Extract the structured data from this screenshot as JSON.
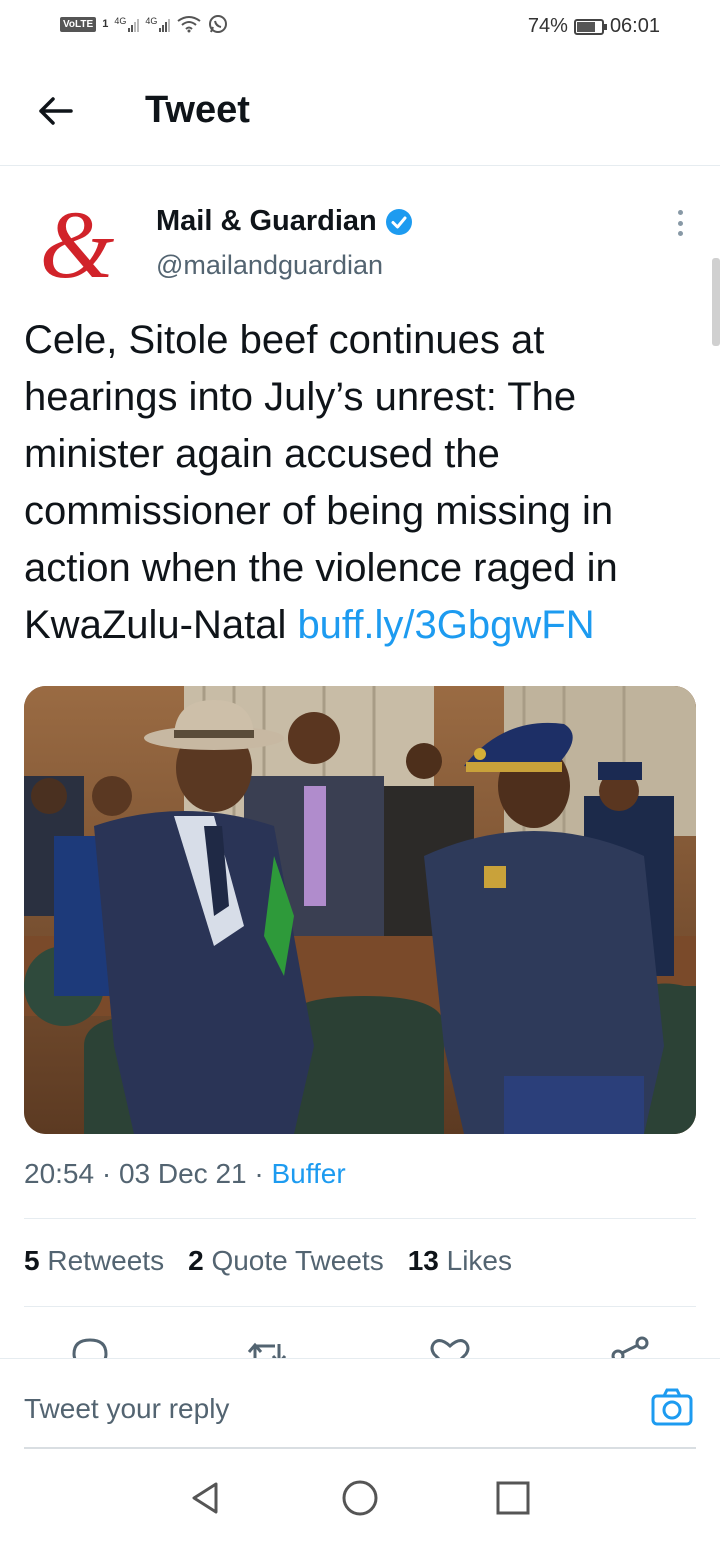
{
  "status_bar": {
    "volte": "VoLTE",
    "sim": "1",
    "net1": "4G",
    "net2": "4G",
    "battery": "74%",
    "battery_level": 0.74,
    "time": "06:01"
  },
  "header": {
    "title": "Tweet",
    "back_icon": "arrow-left-icon"
  },
  "tweet": {
    "avatar_glyph": "&",
    "author_name": "Mail & Guardian",
    "author_handle": "@mailandguardian",
    "text": "Cele, Sitole beef continues at hearings into July’s unrest: The minister again accused the commissioner of being missing in action when the violence raged in KwaZulu-Natal ",
    "link": "buff.ly/3GbgwFN",
    "time": "20:54",
    "date": "03 Dec 21",
    "source": "Buffer",
    "separator": "·"
  },
  "stats": {
    "retweets_count": "5",
    "retweets_label": "Retweets",
    "quotes_count": "2",
    "quotes_label": "Quote Tweets",
    "likes_count": "13",
    "likes_label": "Likes"
  },
  "reply": {
    "placeholder": "Tweet your reply"
  },
  "colors": {
    "accent": "#1d9bf0",
    "text": "#0f1419",
    "secondary": "#536471",
    "brand_red": "#d1232a"
  }
}
